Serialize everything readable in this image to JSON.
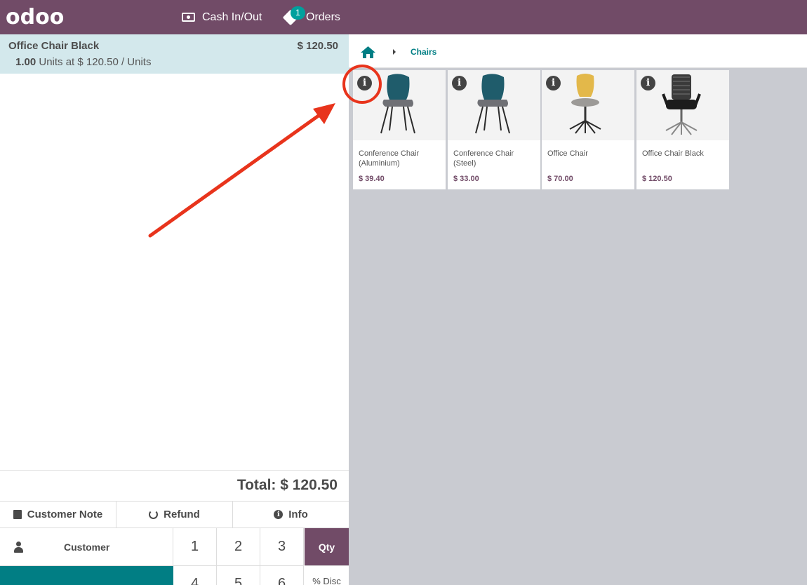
{
  "header": {
    "logo_text": "odoo",
    "cash_label": "Cash In/Out",
    "orders_label": "Orders",
    "orders_badge": "1"
  },
  "order": {
    "line": {
      "name": "Office Chair Black",
      "price": "$ 120.50",
      "qty": "1.00",
      "detail": "Units at $ 120.50 / Units"
    },
    "total_label": "Total: $ 120.50"
  },
  "actions": {
    "customer_note": "Customer Note",
    "refund": "Refund",
    "info": "Info"
  },
  "control": {
    "customer": "Customer"
  },
  "numpad": {
    "k1": "1",
    "k2": "2",
    "k3": "3",
    "qty": "Qty",
    "k4": "4",
    "k5": "5",
    "k6": "6",
    "disc": "% Disc"
  },
  "breadcrumb": {
    "category": "Chairs"
  },
  "products": [
    {
      "name": "Conference Chair (Aluminium)",
      "price": "$ 39.40"
    },
    {
      "name": "Conference Chair (Steel)",
      "price": "$ 33.00"
    },
    {
      "name": "Office Chair",
      "price": "$ 70.00"
    },
    {
      "name": "Office Chair Black",
      "price": "$ 120.50"
    }
  ],
  "colors": {
    "brand": "#714b67",
    "accent": "#017e84",
    "badge": "#00a09d",
    "selected_line": "#d3e8ec",
    "annotation": "#e8341c"
  }
}
